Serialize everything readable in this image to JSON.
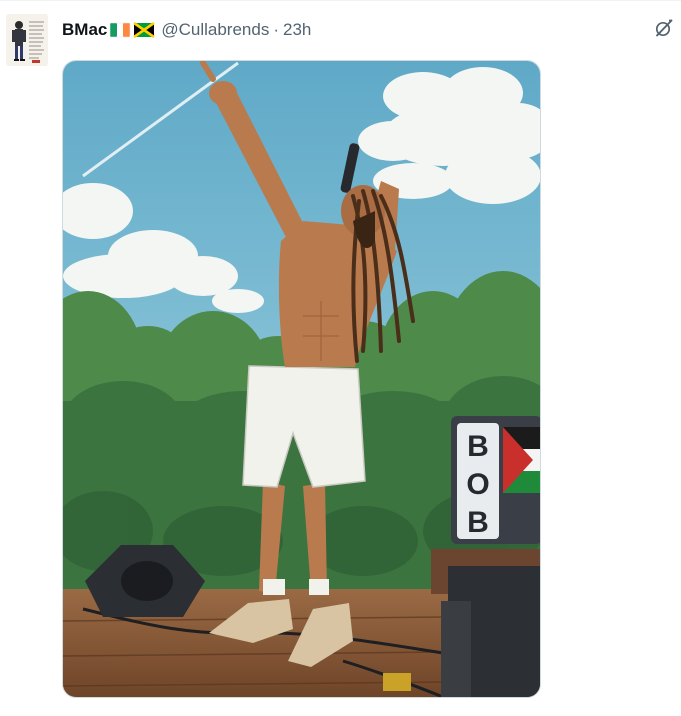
{
  "tweet": {
    "author": {
      "display_name": "BMac",
      "flags": [
        "ireland-flag-icon",
        "jamaica-flag-icon"
      ],
      "handle": "@Cullabrends",
      "separator": "·",
      "time": "23h"
    },
    "actions": {
      "grok_icon": "grok-icon"
    },
    "media": {
      "kind": "illustration",
      "sign_text": "BOB",
      "colors": {
        "sky": "#6cb3cf",
        "cloud": "#f3f6f2",
        "trees": "#4e8a4a",
        "stage": "#8a5a3a",
        "skin": "#b97a4e",
        "shorts": "#f2f2ec"
      }
    }
  }
}
